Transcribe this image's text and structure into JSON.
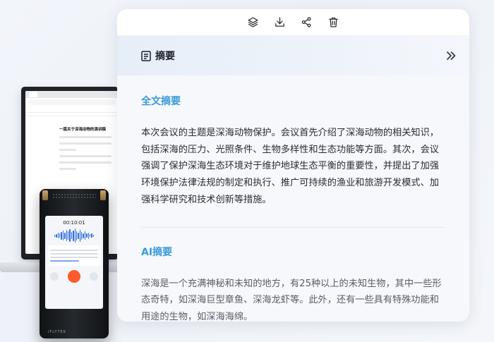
{
  "panel": {
    "toolbar": {
      "icons": [
        "layers-icon",
        "download-icon",
        "share-icon",
        "trash-icon"
      ]
    },
    "header": {
      "title": "摘要",
      "icon": "document-icon",
      "collapse_icon": "double-chevron-right-icon"
    },
    "full_summary": {
      "title": "全文摘要",
      "text": "本次会议的主题是深海动物保护。会议首先介绍了深海动物的相关知识，包括深海的压力、光照条件、生物多样性和生态功能等方面。其次，会议强调了保护深海生态环境对于维护地球生态平衡的重要性，并提出了加强环境保护法律法规的制定和执行、推广可持续的渔业和旅游开发模式、加强科学研究和技术创新等措施。"
    },
    "ai_summary": {
      "title": "AI摘要",
      "text": "深海是一个充满神秘和未知的地方，有25种以上的未知生物，其中一些形态奇特，如深海巨型章鱼、深海龙虾等。此外，还有一些具有特殊功能和用途的生物，如深海海绵。"
    }
  },
  "device": {
    "doc_title": "一篇关于深海动物的演讲稿",
    "recorder_time": "00:10:01",
    "brand": "iFLYTEK"
  },
  "colors": {
    "accent": "#3a9bd8",
    "record_button": "#ff5a2a"
  }
}
